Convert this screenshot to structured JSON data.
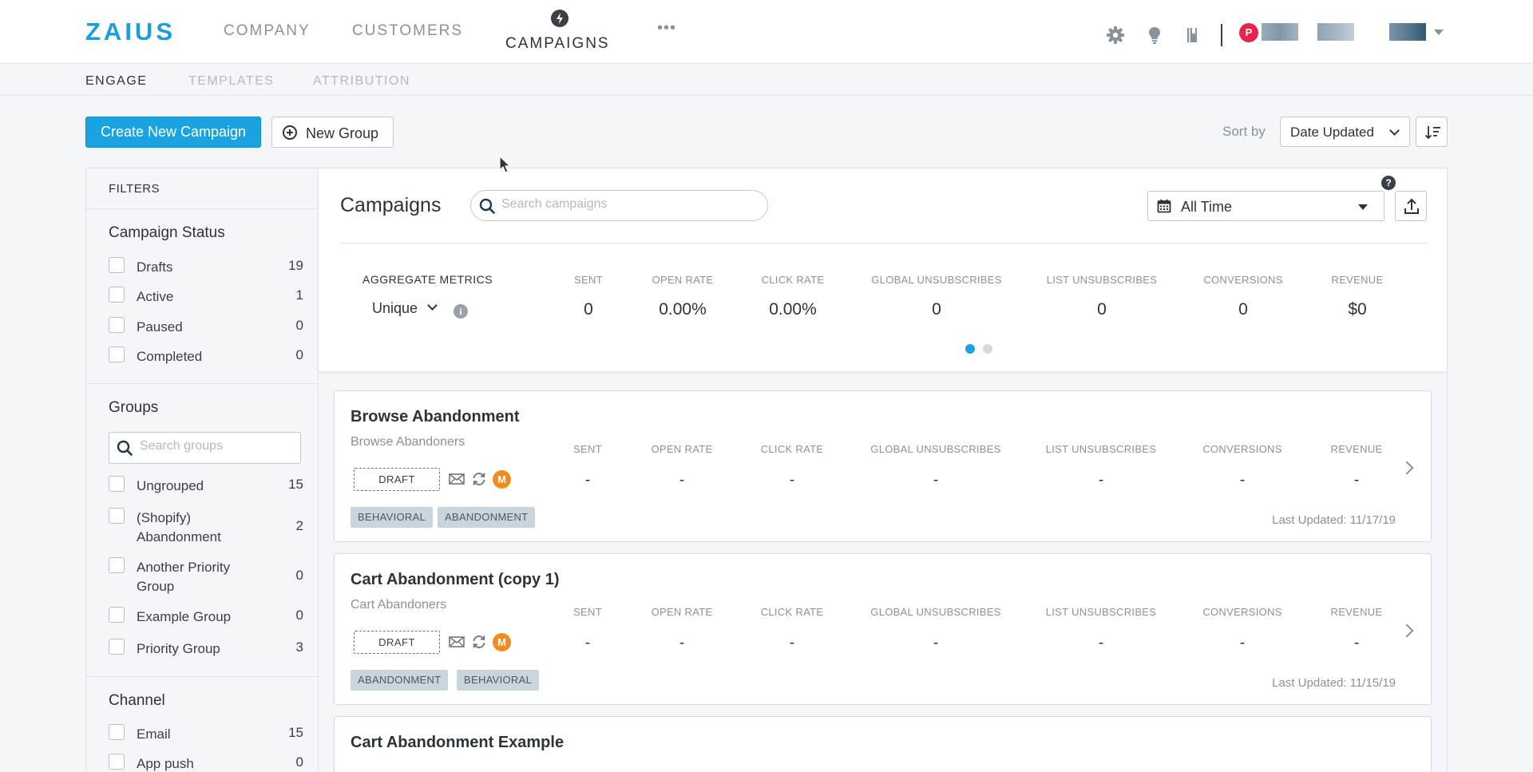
{
  "nav": {
    "logo": "ZAIUS",
    "items": [
      "COMPANY",
      "CUSTOMERS",
      "CAMPAIGNS"
    ],
    "active": "CAMPAIGNS",
    "more": "•••",
    "icons": [
      "gear-icon",
      "lightbulb-icon",
      "book-icon"
    ],
    "avatar_initial": "P"
  },
  "subnav": {
    "items": [
      "ENGAGE",
      "TEMPLATES",
      "ATTRIBUTION"
    ],
    "active": "ENGAGE"
  },
  "actions": {
    "create_label": "Create New Campaign",
    "new_group_label": "New Group",
    "sort_by_label": "Sort by",
    "sort_value": "Date Updated"
  },
  "filters": {
    "title": "FILTERS",
    "status_title": "Campaign Status",
    "status": [
      {
        "label": "Drafts",
        "count": "19"
      },
      {
        "label": "Active",
        "count": "1"
      },
      {
        "label": "Paused",
        "count": "0"
      },
      {
        "label": "Completed",
        "count": "0"
      }
    ],
    "groups_title": "Groups",
    "groups_placeholder": "Search groups",
    "groups": [
      {
        "label": "Ungrouped",
        "count": "15"
      },
      {
        "label": "(Shopify) Abandonment",
        "count": "2"
      },
      {
        "label": "Another Priority Group",
        "count": "0"
      },
      {
        "label": "Example Group",
        "count": "0"
      },
      {
        "label": "Priority Group",
        "count": "3"
      }
    ],
    "channel_title": "Channel",
    "channels": [
      {
        "label": "Email",
        "count": "15"
      },
      {
        "label": "App push",
        "count": "0"
      }
    ]
  },
  "campaigns": {
    "title": "Campaigns",
    "search_placeholder": "Search campaigns",
    "time_range": "All Time",
    "help": "?",
    "aggregate_label": "AGGREGATE METRICS",
    "metric_mode": "Unique",
    "info": "i",
    "metric_headers": [
      "SENT",
      "OPEN RATE",
      "CLICK RATE",
      "GLOBAL UNSUBSCRIBES",
      "LIST UNSUBSCRIBES",
      "CONVERSIONS",
      "REVENUE"
    ],
    "metric_values": [
      "0",
      "0.00%",
      "0.00%",
      "0",
      "0",
      "0",
      "$0"
    ],
    "page_dots": 2,
    "active_dot": 1,
    "items": [
      {
        "name": "Browse Abandonment",
        "segment": "Browse Abandoners",
        "status": "DRAFT",
        "badge": "M",
        "values": [
          "-",
          "-",
          "-",
          "-",
          "-",
          "-",
          "-"
        ],
        "tags": [
          "BEHAVIORAL",
          "ABANDONMENT"
        ],
        "last_updated": "Last Updated: 11/17/19"
      },
      {
        "name": "Cart Abandonment (copy 1)",
        "segment": "Cart Abandoners",
        "status": "DRAFT",
        "badge": "M",
        "values": [
          "-",
          "-",
          "-",
          "-",
          "-",
          "-",
          "-"
        ],
        "tags": [
          "ABANDONMENT",
          "BEHAVIORAL"
        ],
        "last_updated": "Last Updated: 11/15/19"
      },
      {
        "name": "Cart Abandonment Example"
      }
    ]
  },
  "colors": {
    "brand": "#1a9fd8",
    "primary_button": "#1aa3e1",
    "mbadge": "#f28c1c",
    "avatar": "#e8214f",
    "tag_bg": "#c9d5dd"
  }
}
